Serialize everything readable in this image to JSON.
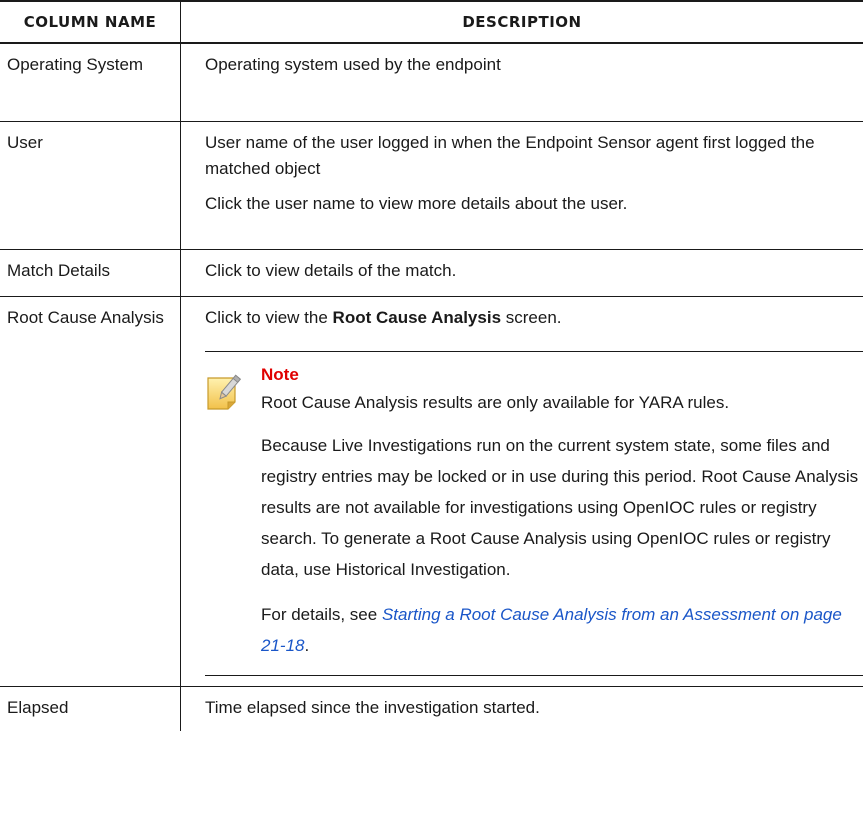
{
  "table": {
    "headers": [
      "Column Name",
      "Description"
    ],
    "rows": [
      {
        "name": "Operating System",
        "desc": [
          "Operating system used by the endpoint"
        ]
      },
      {
        "name": "User",
        "desc": [
          "User name of the user logged in when the Endpoint Sensor agent first logged the matched object",
          "Click the user name to view more details about the user."
        ]
      },
      {
        "name": "Match Details",
        "desc": [
          "Click to view details of the match."
        ]
      },
      {
        "name": "Root Cause Analysis",
        "desc_prefix": "Click to view the ",
        "desc_term": "Root Cause Analysis",
        "desc_suffix": " screen.",
        "note": {
          "title": "Note",
          "icon": "note-pencil-icon",
          "paragraphs": [
            "Root Cause Analysis results are only available for YARA rules.",
            "Because Live Investigations run on the current system state, some files and registry entries may be locked or in use during this period. Root Cause Analysis results are not available for investigations using OpenIOC rules or registry search. To generate a Root Cause Analysis using OpenIOC rules or registry data, use Historical Investigation."
          ],
          "details_prefix": "For details, see ",
          "details_link": "Starting a Root Cause Analysis from an Assessment on page 21-18",
          "details_suffix": "."
        }
      },
      {
        "name": "Elapsed",
        "desc": [
          "Time elapsed since the investigation started."
        ]
      }
    ]
  },
  "colors": {
    "note_title": "#e00000",
    "link": "#1a56c8",
    "rule": "#1a1a1a"
  }
}
